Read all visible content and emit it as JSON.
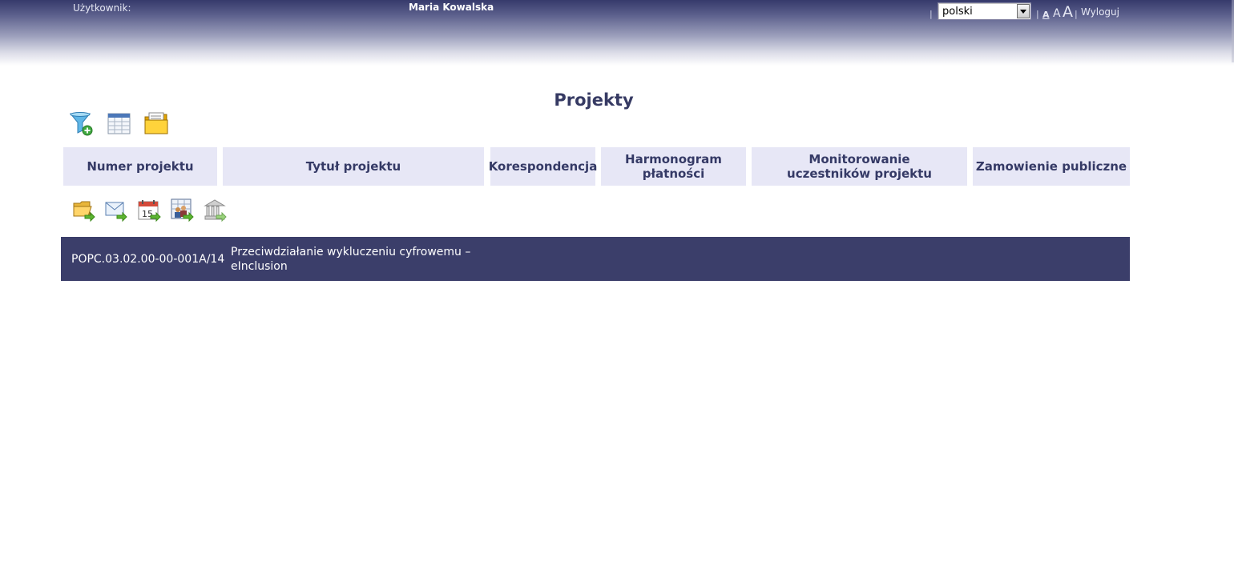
{
  "header": {
    "user_label": "Użytkownik:",
    "user_name": "Maria Kowalska",
    "language": {
      "selected": "polski"
    },
    "font_sizes": [
      "A",
      "A",
      "A"
    ],
    "logout_label": "Wyloguj"
  },
  "page": {
    "title": "Projekty"
  },
  "toolbar": {
    "icons": [
      "filter-add-icon",
      "table-view-icon",
      "folder-icon"
    ]
  },
  "table": {
    "columns": [
      "Numer projektu",
      "Tytuł projektu",
      "Korespondencja",
      "Harmonogram płatności",
      "Monitorowanie uczestników projektu",
      "Zamowienie publiczne"
    ],
    "action_icons": [
      "open-folder-icon",
      "mail-icon",
      "calendar-icon",
      "participants-icon",
      "bank-icon"
    ],
    "rows": [
      {
        "numer": "POPC.03.02.00-00-001A/14",
        "tytul_line1": "Przeciwdziałanie wykluczeniu cyfrowemu –",
        "tytul_line2": "eInclusion"
      }
    ]
  },
  "colors": {
    "header_dark": "#363a6b",
    "column_header_bg": "#e7e7f6",
    "row_bg": "#3b3e6a"
  }
}
